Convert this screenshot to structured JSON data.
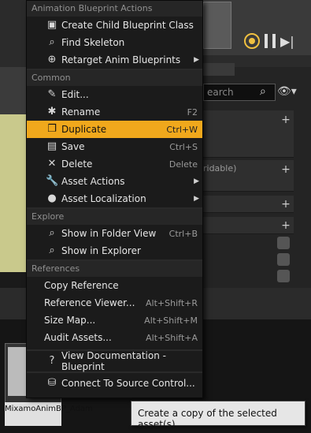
{
  "menu": {
    "sections": {
      "animation": "Animation Blueprint Actions",
      "common": "Common",
      "explore": "Explore",
      "references": "References"
    },
    "items": {
      "create_child": {
        "label": "Create Child Blueprint Class",
        "icon": "blueprint-icon"
      },
      "find_skeleton": {
        "label": "Find Skeleton",
        "icon": "magnify-icon"
      },
      "retarget": {
        "label": "Retarget Anim Blueprints",
        "icon": "crosshair-icon"
      },
      "edit": {
        "label": "Edit...",
        "icon": "pencil-icon"
      },
      "rename": {
        "label": "Rename",
        "shortcut": "F2",
        "icon": "rename-icon"
      },
      "duplicate": {
        "label": "Duplicate",
        "shortcut": "Ctrl+W",
        "icon": "duplicate-icon"
      },
      "save": {
        "label": "Save",
        "shortcut": "Ctrl+S",
        "icon": "save-icon"
      },
      "delete": {
        "label": "Delete",
        "shortcut": "Delete",
        "icon": "delete-icon"
      },
      "asset_actions": {
        "label": "Asset Actions",
        "icon": "wrench-icon"
      },
      "asset_localization": {
        "label": "Asset Localization",
        "icon": "globe-icon"
      },
      "show_folder": {
        "label": "Show in Folder View",
        "shortcut": "Ctrl+B",
        "icon": "magnify-icon"
      },
      "show_explorer": {
        "label": "Show in Explorer",
        "icon": "magnify-icon"
      },
      "copy_reference": {
        "label": "Copy Reference"
      },
      "reference_viewer": {
        "label": "Reference Viewer...",
        "shortcut": "Alt+Shift+R"
      },
      "size_map": {
        "label": "Size Map...",
        "shortcut": "Alt+Shift+M"
      },
      "audit_assets": {
        "label": "Audit Assets...",
        "shortcut": "Alt+Shift+A"
      },
      "view_docs": {
        "label": "View Documentation - Blueprint",
        "icon": "help-icon"
      },
      "connect_source": {
        "label": "Connect To Source Control...",
        "icon": "source-control-icon"
      }
    },
    "accent_color": "#f0a81c"
  },
  "background": {
    "search_placeholder": "earch",
    "overridable_text": "ridable)",
    "asset_name": "MixamoAnimBP_Adam"
  },
  "tooltip": {
    "text": "Create a copy of the selected asset(s)."
  }
}
